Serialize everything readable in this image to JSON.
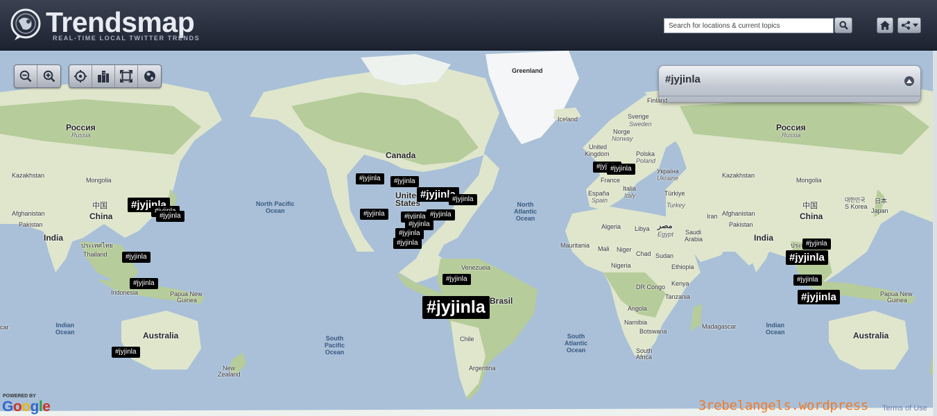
{
  "header": {
    "logo_title": "Trendsmap",
    "logo_subtitle": "REAL-TIME LOCAL TWITTER TRENDS",
    "search_placeholder": "Search for locations & current topics",
    "icons": [
      "search-icon",
      "home-icon",
      "share-icon",
      "chevron-down-icon"
    ]
  },
  "map_controls": {
    "icons": [
      "zoom-out-icon",
      "zoom-in-icon",
      "locate-icon",
      "city-icon",
      "fullscreen-icon",
      "globe-icon"
    ]
  },
  "panel": {
    "title": "#jyjinla",
    "icon": "collapse-icon"
  },
  "labels": {
    "greenland": "Greenland",
    "iceland": "Iceland",
    "finland": "Finland",
    "sverige": "Sverige",
    "sweden": "Sweden",
    "norge": "Norge",
    "norway": "Norway",
    "uk1": "United",
    "uk2": "Kingdom",
    "polska": "Polska",
    "poland": "Poland",
    "ukraina": "Україна",
    "ukraine": "Ukraine",
    "france": "France",
    "espana": "España",
    "spain": "Spain",
    "italia": "Italia",
    "italy": "Italy",
    "turkiye": "Türkiye",
    "turkey": "Turkey",
    "russia_l": "Россия",
    "russia_l_sub": "Russia",
    "russia_r": "Россия",
    "russia_r_sub": "Russia",
    "kazakh_l": "Kazakhstan",
    "kazakh_r": "Kazakhstan",
    "mongolia_l": "Mongolia",
    "mongolia_r": "Mongolia",
    "china_cn_l": "中国",
    "china_l": "China",
    "china_cn_r": "中国",
    "china_r": "China",
    "afghan_l": "Afghanistan",
    "afghan_r": "Afghanistan",
    "pakistan_l": "Pakistan",
    "pakistan_r": "Pakistan",
    "india_l": "India",
    "india_r": "India",
    "thai_native_l": "ประเทศไทย",
    "thai_native_r": "ประเท",
    "thailand_l": "Thailand",
    "indonesia_l": "Indonesia",
    "png_l1": "Papua New",
    "png_l2": "Guinea",
    "png_r1": "Papua New",
    "png_r2": "Guinea",
    "australia_l": "Australia",
    "australia_r": "Australia",
    "nz1": "New",
    "nz2": "Zealand",
    "japan_native": "日本",
    "japan": "Japan",
    "korea_native": "대한민국",
    "korea": "S Korea",
    "iran": "Iran",
    "saudi1": "Saudi",
    "saudi2": "Arabia",
    "egypt_native": "مصر",
    "egypt": "Egypt",
    "algeria": "Algeria",
    "libya": "Libya",
    "mali": "Mali",
    "niger": "Niger",
    "chad": "Chad",
    "sudan": "Sudan",
    "mauritania": "Mauritania",
    "nigeria": "Nigeria",
    "ethiopia": "Ethiopia",
    "drc": "DR Congo",
    "kenya": "Kenya",
    "tanzania": "Tanzania",
    "angola": "Angola",
    "namibia": "Namibia",
    "botswana": "Botswana",
    "madagascar": "Madagascar",
    "sa1": "South",
    "sa2": "Africa",
    "canada": "Canada",
    "us1": "United",
    "us2": "States",
    "venezuela": "Venezuela",
    "brasil": "Brasil",
    "chile": "Chile",
    "argentina": "Argentina",
    "npo1": "North Pacific",
    "npo2": "Ocean",
    "nao1": "North",
    "nao2": "Atlantic",
    "nao3": "Ocean",
    "spo1": "South",
    "spo2": "Pacific",
    "spo3": "Ocean",
    "sao1": "South",
    "sao2": "Atlantic",
    "sao3": "Ocean",
    "io_l1": "Indian",
    "io_l2": "Ocean",
    "io_r1": "Indian",
    "io_r2": "Ocean",
    "car": "car"
  },
  "trend_tags": [
    {
      "text": "#jyjinla",
      "size": "m"
    },
    {
      "text": "#jyjinla",
      "size": "s"
    },
    {
      "text": "#jyjinla",
      "size": "s"
    },
    {
      "text": "#jyjinla",
      "size": "s"
    },
    {
      "text": "#jyjinla",
      "size": "s"
    },
    {
      "text": "#jyjinla",
      "size": "s"
    },
    {
      "text": "#jyjinla",
      "size": "s"
    },
    {
      "text": "#jyjinla",
      "size": "m"
    },
    {
      "text": "#jyjinla",
      "size": "s"
    },
    {
      "text": "#jyjinla",
      "size": "s"
    },
    {
      "text": "#jyjinla",
      "size": "s"
    },
    {
      "text": "#jyjinla",
      "size": "s"
    },
    {
      "text": "#jyjinla",
      "size": "s"
    },
    {
      "text": "#jyjinla",
      "size": "s"
    },
    {
      "text": "#jyjinla",
      "size": "s"
    },
    {
      "text": "#jyjinla",
      "size": "s"
    },
    {
      "text": "#jyjinla",
      "size": "s"
    },
    {
      "text": "#jyjinla",
      "size": "l"
    },
    {
      "text": "#jyjinla",
      "size": "s"
    },
    {
      "text": "#jyjinla",
      "size": "s"
    },
    {
      "text": "#jyjinla",
      "size": "s"
    },
    {
      "text": "#jyjinla",
      "size": "m"
    },
    {
      "text": "#jyjinla",
      "size": "s"
    },
    {
      "text": "#jyjinla",
      "size": "m"
    }
  ],
  "footer": {
    "powered_by": "POWERED BY",
    "google": [
      "G",
      "o",
      "o",
      "g",
      "l",
      "e"
    ],
    "google_colors": [
      "#3266cc",
      "#cc3322",
      "#f2b50f",
      "#3266cc",
      "#2e9e3e",
      "#cc3322"
    ],
    "watermark": "3rebelangels.wordpress",
    "terms": "Terms of Use"
  },
  "colors": {
    "ocean": "#a9c0d8",
    "land": "#dfe6cc",
    "forest": "#b6cc9a",
    "ice": "#f4f6f7",
    "header": "#1c2230",
    "tag": "#000000",
    "watermark": "#f07a2a"
  }
}
